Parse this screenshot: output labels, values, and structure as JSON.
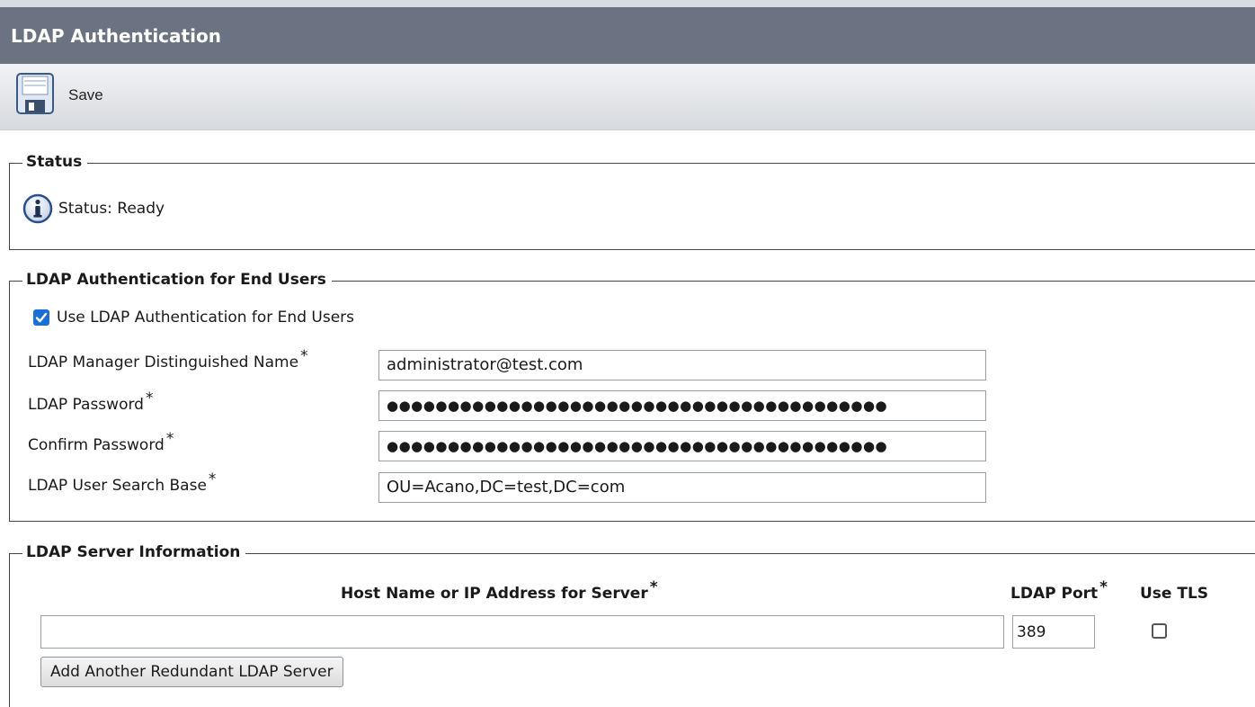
{
  "header": {
    "title": "LDAP Authentication"
  },
  "toolbar": {
    "save_label": "Save",
    "save_icon": "floppy-disk-icon"
  },
  "status": {
    "legend": "Status",
    "icon": "info-icon",
    "text": "Status: Ready"
  },
  "end_users": {
    "legend": "LDAP Authentication for End Users",
    "use_ldap_label": "Use LDAP Authentication for End Users",
    "use_ldap_checked": true,
    "required_mark": "*",
    "fields": [
      {
        "label": "LDAP Manager Distinguished Name",
        "value": "administrator@test.com"
      },
      {
        "label": "LDAP Password",
        "value": "●●●●●●●●●●●●●●●●●●●●●●●●●●●●●●●●●●●●●●●●●"
      },
      {
        "label": "Confirm Password",
        "value": "●●●●●●●●●●●●●●●●●●●●●●●●●●●●●●●●●●●●●●●●●"
      },
      {
        "label": "LDAP User Search Base",
        "value": "OU=Acano,DC=test,DC=com"
      }
    ]
  },
  "server": {
    "legend": "LDAP Server Information",
    "host_header": "Host Name or IP Address for Server",
    "port_header": "LDAP Port",
    "tls_header": "Use TLS",
    "required_mark": "*",
    "host_value": "",
    "port_value": "389",
    "use_tls": false,
    "add_button_label": "Add Another Redundant LDAP Server"
  },
  "colors": {
    "title_bar": "#6b7382",
    "checkbox_accent": "#1a6fd6",
    "info_icon": "#2a4f8a"
  }
}
